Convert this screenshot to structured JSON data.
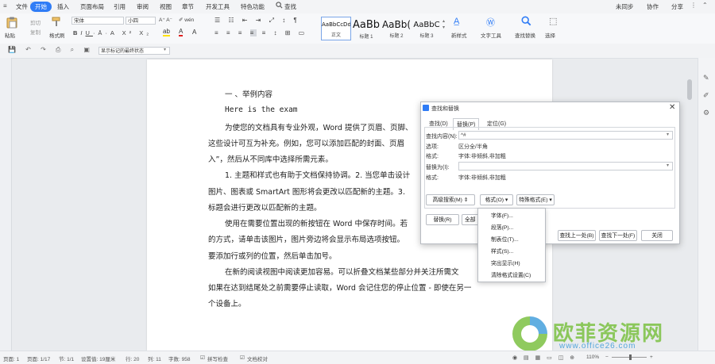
{
  "menubar": {
    "file": "文件",
    "items": [
      "开始",
      "插入",
      "页面布局",
      "引用",
      "审阅",
      "视图",
      "章节",
      "开发工具",
      "特色功能"
    ],
    "search": "查找",
    "right": [
      "未同步",
      "协作",
      "分享"
    ]
  },
  "ribbon": {
    "paste": "粘贴",
    "cut": "剪切",
    "copy": "复制",
    "format_painter": "格式刷",
    "font_name": "宋体",
    "font_size": "小四",
    "styles": [
      {
        "sample": "AaBbCcDd",
        "name": "正文"
      },
      {
        "sample": "AaBb",
        "name": "标题 1"
      },
      {
        "sample": "AaBb(",
        "name": "标题 2"
      },
      {
        "sample": "AaBbC",
        "name": "标题 3"
      }
    ],
    "new_style": "新样式",
    "text_tools": "文字工具",
    "find_replace": "查找替换",
    "select": "选择"
  },
  "qbar": {
    "track_mode": "显示标记的最终状态"
  },
  "document": {
    "lines": [
      "一 、举例内容",
      "Here is the exam",
      "为使您的文档具有专业外观，Word 提供了页眉、页脚、",
      "这些设计可互为补充。例如，您可以添加匹配的封面、页眉",
      "入”，然后从不同库中选择所需元素。",
      "1. 主题和样式也有助于文档保持协调。2. 当您单击设计",
      "图片、图表或 SmartArt 图形将会更改以匹配新的主题。3.",
      "标题会进行更改以匹配新的主题。",
      "使用在需要位置出现的新按钮在 Word 中保存时间。若",
      "的方式，请单击该图片，图片旁边将会显示布局选项按钮。",
      "要添加行或列的位置，然后单击加号。",
      "在新的阅读视图中阅读更加容易。可以折叠文档某些部分并关注所需文",
      "如果在达到结尾处之前需要停止读取，Word 会记住您的停止位置 - 即使在另一",
      "个设备上。"
    ]
  },
  "dialog": {
    "title": "查找和替换",
    "tabs": [
      "查找(D)",
      "替换(P)",
      "定位(G)"
    ],
    "find_label": "查找内容(N):",
    "find_value": "^#",
    "options_label": "选项:",
    "options_value": "区分全/半角",
    "format_label": "格式:",
    "format_value": "字体:非倾斜,非加粗",
    "replace_label": "替换为(I):",
    "replace_value": "",
    "format2_label": "格式:",
    "format2_value": "字体:非倾斜,非加粗",
    "advanced_button": "高级搜索(M)",
    "format_button": "格式(O)",
    "special_button": "特殊格式(E)",
    "replace_button": "替换(R)",
    "replace_all_button": "全部",
    "find_prev_button": "查找上一处(B)",
    "find_next_button": "查找下一处(F)",
    "close_button": "关闭"
  },
  "dropdown": {
    "items": [
      "字体(F)...",
      "段落(P)...",
      "制表位(T)...",
      "样式(S)...",
      "突出显示(H)",
      "清除格式设置(C)"
    ]
  },
  "status": {
    "page": "页面: 1",
    "page_of": "页面: 1/17",
    "section": "节: 1/1",
    "position": "设置值: 19厘米",
    "row": "行: 20",
    "col": "列: 11",
    "words": "字数: 958",
    "spell": "拼写检查",
    "proof": "文档校对",
    "zoom": "110%"
  },
  "watermark": {
    "text": "欧菲资源网",
    "url": "www.office26.com"
  },
  "colors": {
    "accent": "#2f7cf6",
    "watermark_green": "#7bc142"
  }
}
